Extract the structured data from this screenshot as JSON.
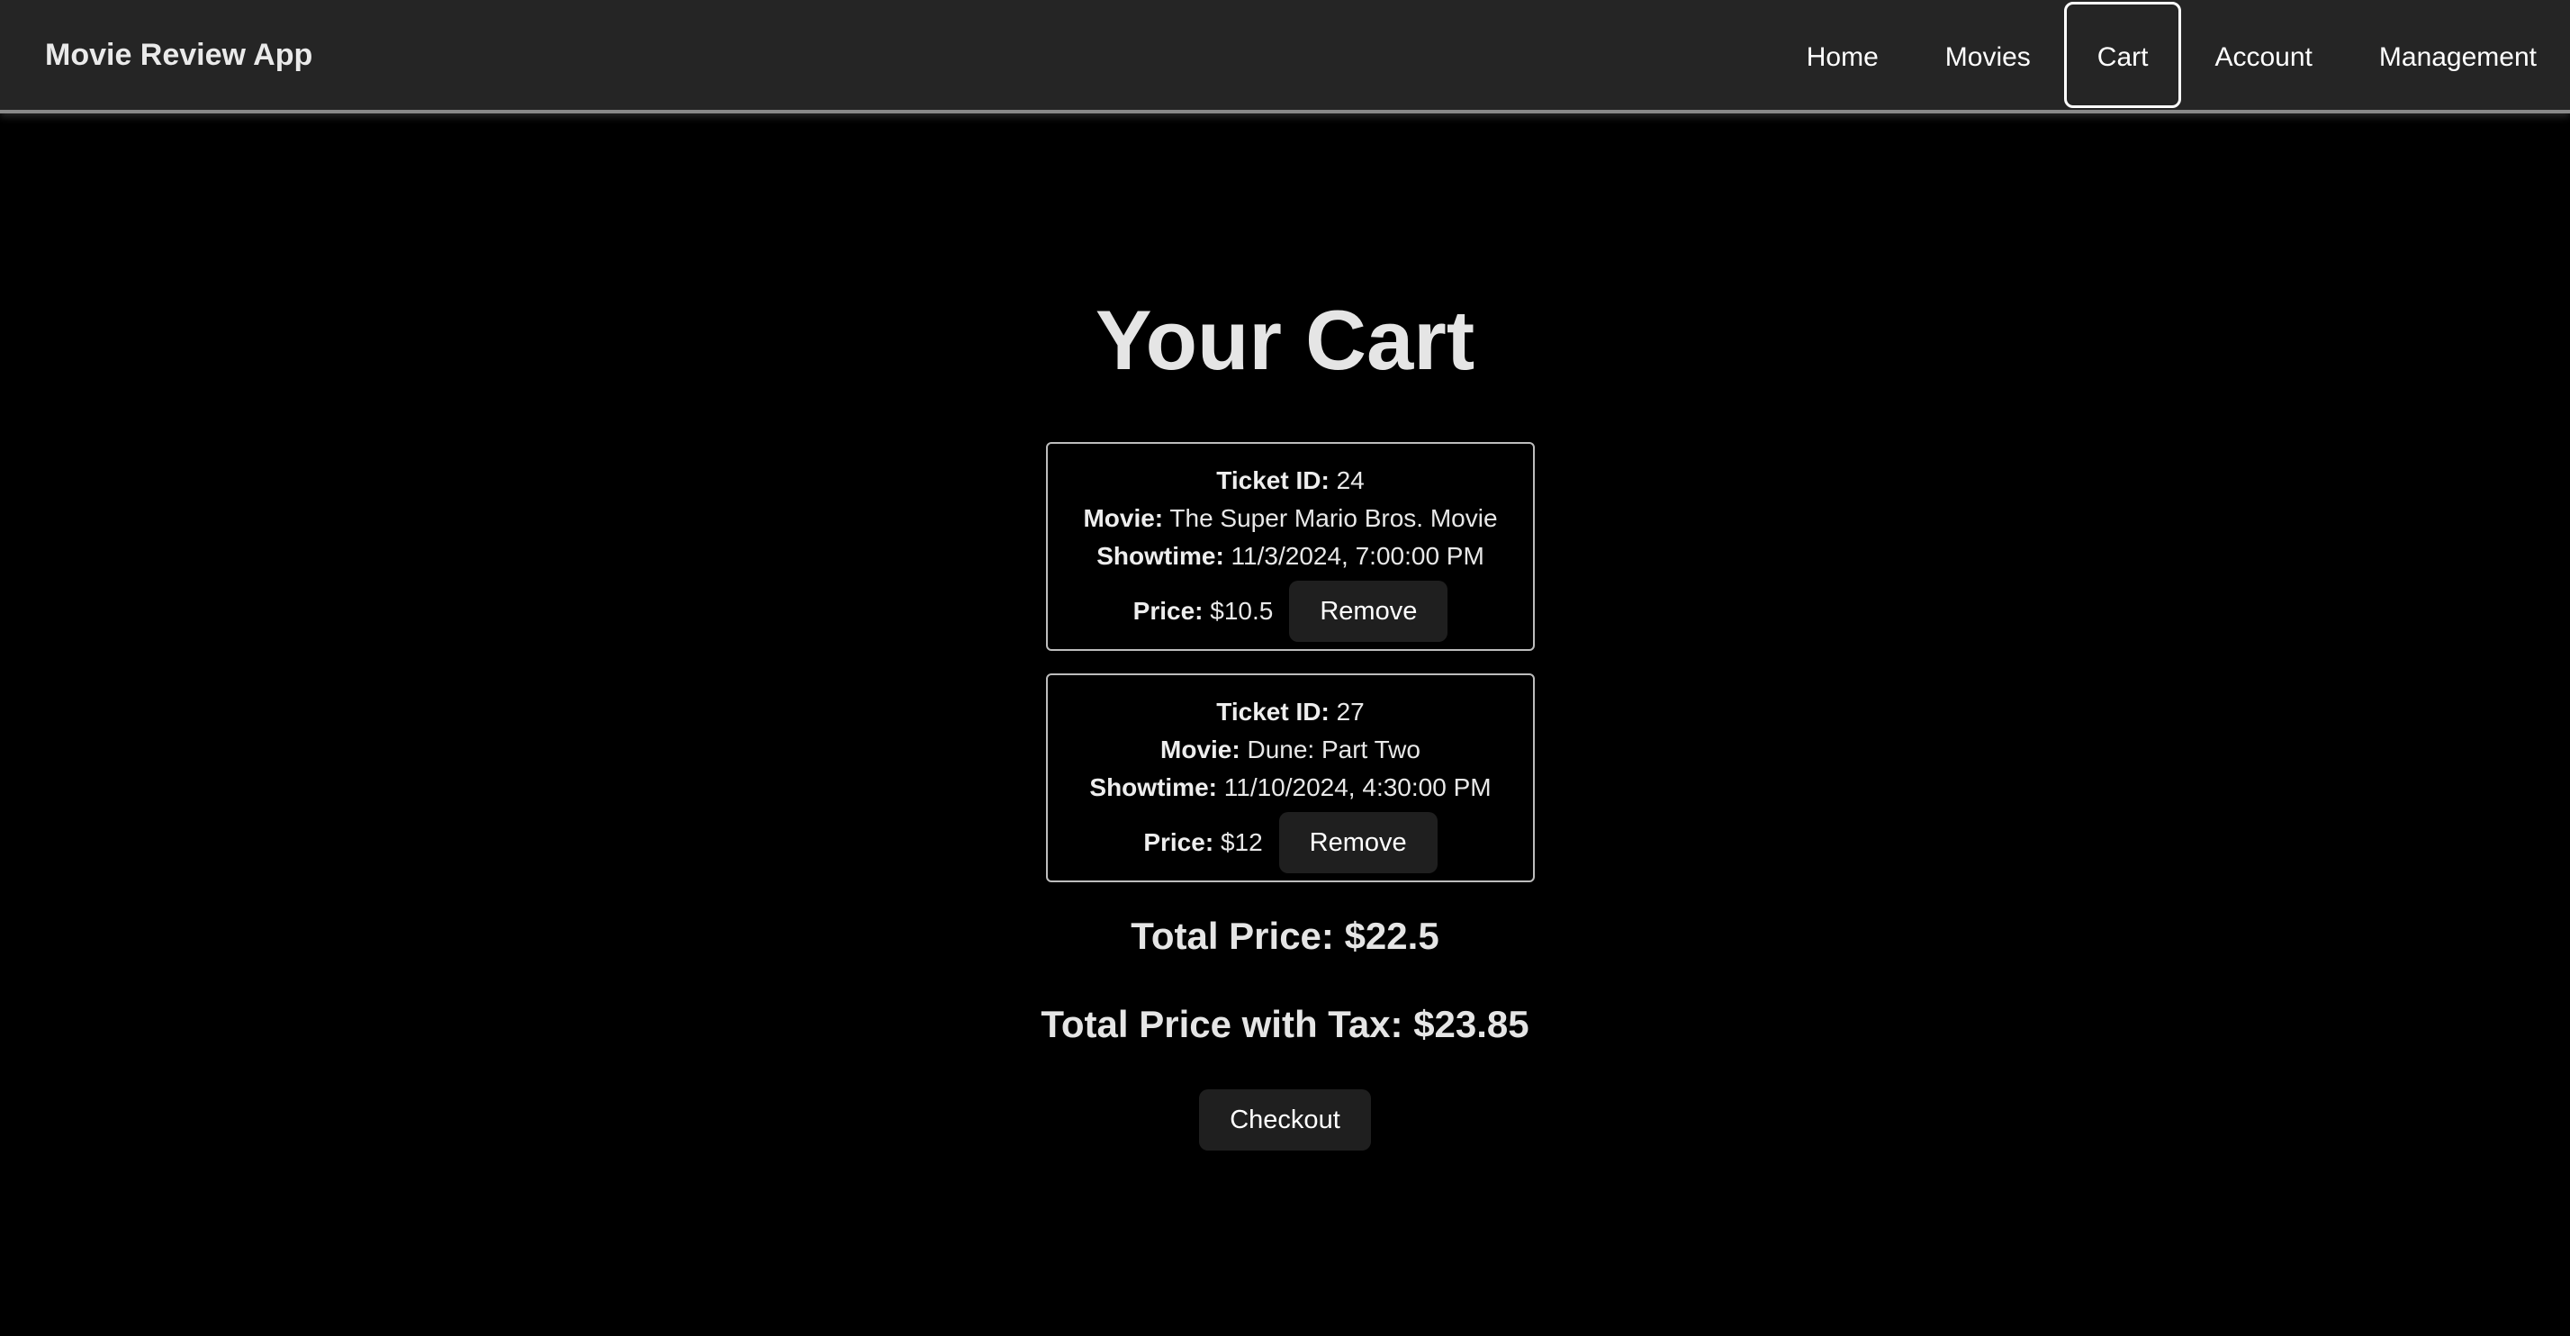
{
  "app": {
    "brand": "Movie Review App"
  },
  "nav": {
    "items": [
      {
        "label": "Home"
      },
      {
        "label": "Movies"
      },
      {
        "label": "Cart",
        "active": true
      },
      {
        "label": "Account"
      },
      {
        "label": "Management"
      }
    ]
  },
  "page": {
    "title": "Your Cart"
  },
  "labels": {
    "ticket_id": "Ticket ID:",
    "movie": "Movie:",
    "showtime": "Showtime:",
    "price": "Price:",
    "remove": "Remove"
  },
  "cart": {
    "items": [
      {
        "ticket_id": "24",
        "movie": "The Super Mario Bros. Movie",
        "showtime": "11/3/2024, 7:00:00 PM",
        "price": "$10.5"
      },
      {
        "ticket_id": "27",
        "movie": "Dune: Part Two",
        "showtime": "11/10/2024, 4:30:00 PM",
        "price": "$12"
      }
    ],
    "total_price": "Total Price: $22.5",
    "total_with_tax": "Total Price with Tax: $23.85",
    "checkout_label": "Checkout"
  },
  "colors": {
    "background": "#000000",
    "header": "#252525",
    "button": "#1f1f1f",
    "text": "#e8e8e8"
  }
}
